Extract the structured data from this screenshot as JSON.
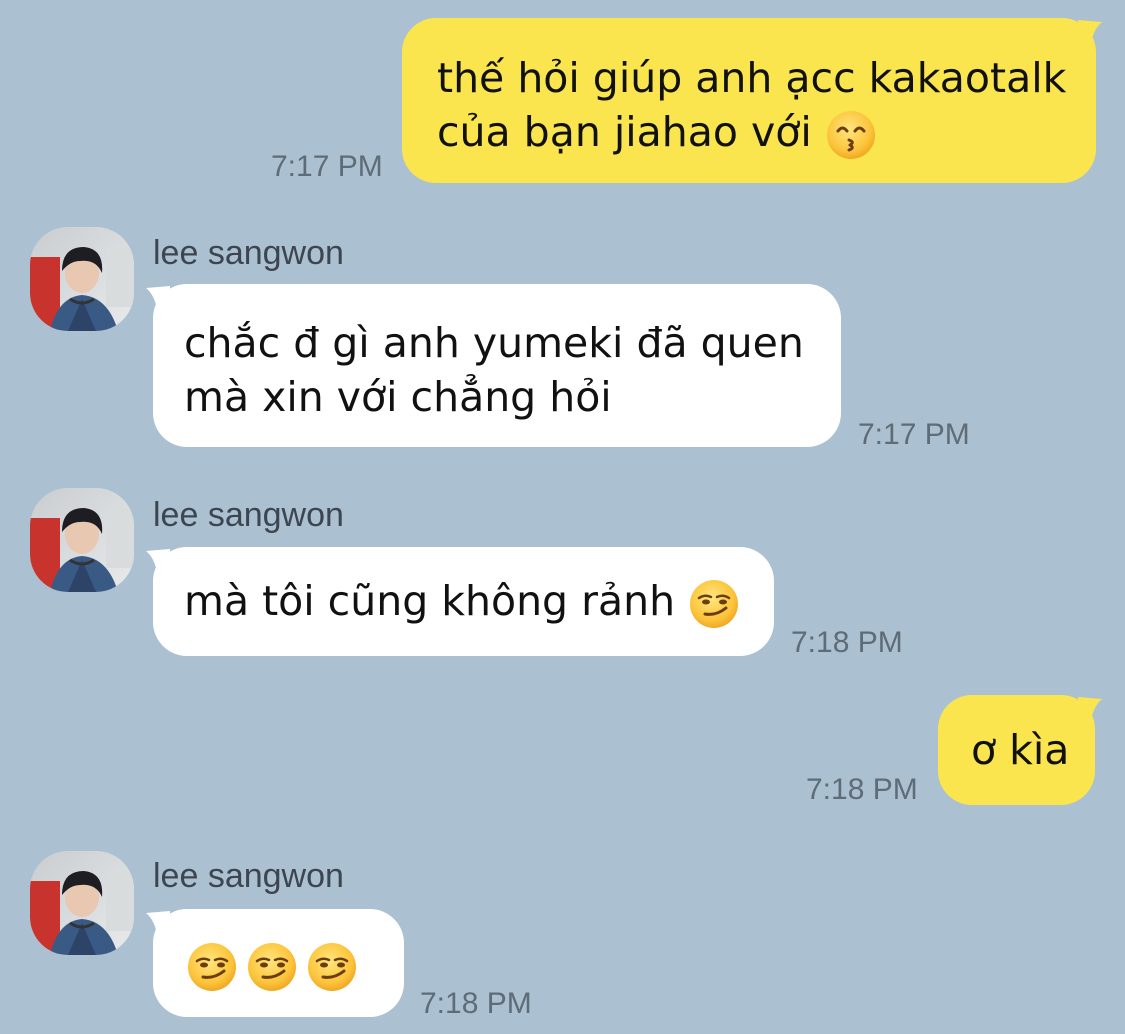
{
  "contact": {
    "name": "lee sangwon"
  },
  "messages": [
    {
      "sender": "me",
      "lines": [
        "thế hỏi giúp anh ạcc kakaotalk",
        "của bạn jiahao với"
      ],
      "emoji": "kissing-face-with-smiling-eyes-emoji",
      "time": "7:17 PM"
    },
    {
      "sender": "them",
      "name": "lee sangwon",
      "lines": [
        "chắc đ gì anh yumeki đã quen",
        "mà xin với chẳng hỏi"
      ],
      "time": "7:17 PM"
    },
    {
      "sender": "them",
      "name": "lee sangwon",
      "lines": [
        "mà tôi cũng không rảnh"
      ],
      "emoji": "smirking-face-emoji",
      "time": "7:18 PM"
    },
    {
      "sender": "me",
      "lines": [
        "ơ kìa"
      ],
      "time": "7:18 PM"
    },
    {
      "sender": "them",
      "name": "lee sangwon",
      "emojis": [
        "smirking-face-emoji",
        "smirking-face-emoji",
        "smirking-face-emoji"
      ],
      "time": "7:18 PM"
    }
  ],
  "colors": {
    "background": "#abc1d1",
    "my_bubble": "#fae54e",
    "their_bubble": "#ffffff",
    "timestamp": "#5e6c78",
    "sender_name": "#3d4650"
  }
}
